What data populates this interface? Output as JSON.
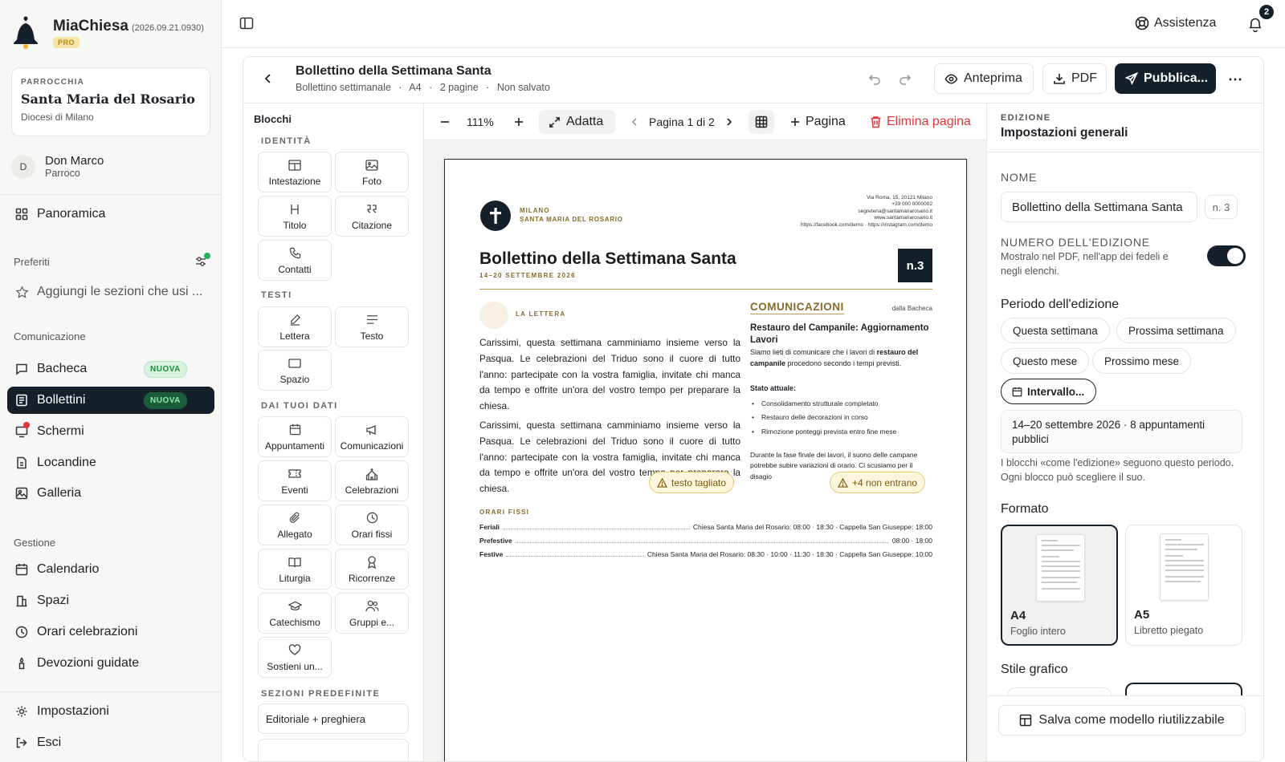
{
  "brand": {
    "name": "MiaChiesa",
    "version": "(2026.09.21.0930)",
    "badge": "PRO"
  },
  "parish": {
    "label": "PARROCCHIA",
    "name": "Santa Maria del Rosario",
    "diocese": "Diocesi di Milano"
  },
  "user": {
    "initial": "D",
    "name": "Don Marco",
    "role": "Parroco"
  },
  "nav": {
    "overview": "Panoramica",
    "favorites_title": "Preferiti",
    "favorites_hint": "Aggiungi le sezioni che usi ...",
    "communication_title": "Comunicazione",
    "communication": [
      {
        "label": "Bacheca",
        "badge": "NUOVA"
      },
      {
        "label": "Bollettini",
        "badge": "NUOVA",
        "active": true
      },
      {
        "label": "Schermi"
      },
      {
        "label": "Locandine"
      },
      {
        "label": "Galleria"
      }
    ],
    "management_title": "Gestione",
    "management": [
      {
        "label": "Calendario"
      },
      {
        "label": "Spazi"
      },
      {
        "label": "Orari celebrazioni"
      },
      {
        "label": "Devozioni guidate"
      }
    ],
    "settings": "Impostazioni",
    "logout": "Esci"
  },
  "topbar": {
    "help": "Assistenza",
    "notifications_count": "2"
  },
  "editor": {
    "title": "Bollettino della Settimana Santa",
    "meta": [
      "Bollettino settimanale",
      "·",
      "A4",
      "·",
      "2 pagine",
      "·",
      "Non salvato"
    ],
    "preview": "Anteprima",
    "pdf": "PDF",
    "publish": "Pubblica..."
  },
  "blocks": {
    "title": "Blocchi",
    "groups": [
      {
        "title": "IDENTITÀ",
        "items": [
          {
            "label": "Intestazione",
            "icon": "layout-header-icon"
          },
          {
            "label": "Foto",
            "icon": "image-icon"
          },
          {
            "label": "Titolo",
            "icon": "heading-icon"
          },
          {
            "label": "Citazione",
            "icon": "quote-icon"
          },
          {
            "label": "Contatti",
            "icon": "phone-icon"
          }
        ]
      },
      {
        "title": "TESTI",
        "items": [
          {
            "label": "Lettera",
            "icon": "pen-icon"
          },
          {
            "label": "Testo",
            "icon": "text-icon"
          },
          {
            "label": "Spazio",
            "icon": "spacer-icon"
          }
        ]
      },
      {
        "title": "DAI TUOI DATI",
        "items": [
          {
            "label": "Appuntamenti",
            "icon": "calendar-icon"
          },
          {
            "label": "Comunicazioni",
            "icon": "megaphone-icon"
          },
          {
            "label": "Eventi",
            "icon": "ticket-icon"
          },
          {
            "label": "Celebrazioni",
            "icon": "church-icon"
          },
          {
            "label": "Allegato",
            "icon": "paperclip-icon"
          },
          {
            "label": "Orari fissi",
            "icon": "clock-icon"
          },
          {
            "label": "Liturgia",
            "icon": "book-icon"
          },
          {
            "label": "Ricorrenze",
            "icon": "ribbon-icon"
          },
          {
            "label": "Catechismo",
            "icon": "graduation-cap-icon"
          },
          {
            "label": "Gruppi e...",
            "icon": "users-icon"
          },
          {
            "label": "Sostieni un...",
            "icon": "heart-hand-icon"
          }
        ]
      },
      {
        "title": "SEZIONI PREDEFINITE",
        "items": [
          {
            "label": "Editoriale + preghiera"
          }
        ]
      }
    ]
  },
  "canvas_toolbar": {
    "zoom": "111%",
    "fit": "Adatta",
    "page_indicator": "Pagina 1 di 2",
    "add_page": "Pagina",
    "delete_page": "Elimina pagina"
  },
  "page": {
    "city": "MILANO",
    "parish": "SANTA MARIA DEL ROSARIO",
    "contacts": [
      "Via Roma, 15, 20121 Milano",
      "+39 000 0000002",
      "segreteria@santamariarosario.it",
      "www.santamariarosario.it",
      "https://facebook.com/demo · https://instagram.com/demo"
    ],
    "title": "Bollettino della Settimana Santa",
    "dates": "14–20 SETTEMBRE 2026",
    "number": "n.3",
    "letter_label": "LA LETTERA",
    "letter_paragraphs": [
      "Carissimi, questa settimana camminiamo insieme verso la Pasqua. Le celebrazioni del Triduo sono il cuore di tutto l'anno: partecipate con la vostra famiglia, invitate chi manca da tempo e offrite un'ora del vostro tempo per preparare la chiesa.",
      "Carissimi, questa settimana camminiamo insieme verso la Pasqua. Le celebrazioni del Triduo sono il cuore di tutto l'anno: partecipate con la vostra famiglia, invitate chi manca da tempo e offrite un'ora del vostro tempo per preparare la chiesa."
    ],
    "comms_title": "COMUNICAZIONI",
    "comms_source": "dalla Bacheca",
    "comm_title": "Restauro del Campanile: Aggiornamento Lavori",
    "comm_intro_a": "Siamo lieti di comunicare che i lavori di ",
    "comm_intro_b": "restauro del campanile",
    "comm_intro_c": " procedono secondo i tempi previsti.",
    "state_label": "Stato attuale:",
    "state_items": [
      "Consolidamento strutturale completato",
      "Restauro delle decorazioni in corso",
      "Rimozione ponteggi prevista entro fine mese"
    ],
    "closing": "Durante la fase finale dei lavori, il suono delle campane potrebbe subire variazioni di orario. Ci scusiamo per il disagio",
    "warn_cut": "testo tagliato",
    "warn_more": "+4 non entrano",
    "hours_label": "ORARI FISSI",
    "hours": [
      {
        "k": "Feriali",
        "v": "Chiesa Santa Maria del Rosario: 08:00 · 18:30 · Cappella San Giuseppe: 18:00"
      },
      {
        "k": "Prefestive",
        "v": "08:00 · 18:00"
      },
      {
        "k": "Festive",
        "v": "Chiesa Santa Maria del Rosario: 08:30 · 10:00 · 11:30 · 18:30 · Cappella San Giuseppe: 10:00"
      }
    ]
  },
  "props": {
    "section_label": "EDIZIONE",
    "section_title": "Impostazioni generali",
    "name_label": "NOME",
    "name_value": "Bollettino della Settimana Santa",
    "number_chip": "n. 3",
    "number_label": "NUMERO DELL'EDIZIONE",
    "number_hint": "Mostralo nel PDF, nell'app dei fedeli e negli elenchi.",
    "period_title": "Periodo dell'edizione",
    "period_chips": [
      "Questa settimana",
      "Prossima settimana",
      "Questo mese",
      "Prossimo mese",
      "Intervallo..."
    ],
    "period_summary": "14–20 settembre 2026 · 8 appuntamenti pubblici",
    "period_hint": "I blocchi «come l'edizione» seguono questo periodo. Ogni blocco può scegliere il suo.",
    "format_title": "Formato",
    "formats": [
      {
        "name": "A4",
        "desc": "Foglio intero",
        "selected": true
      },
      {
        "name": "A5",
        "desc": "Libretto piegato"
      }
    ],
    "style_title": "Stile grafico",
    "save_template": "Salva come modello riutilizzabile"
  },
  "colors": {
    "accent_dark": "#15202b",
    "gold": "#8a6a2a",
    "danger": "#e0363c",
    "new_badge": "#1f8a3e"
  }
}
